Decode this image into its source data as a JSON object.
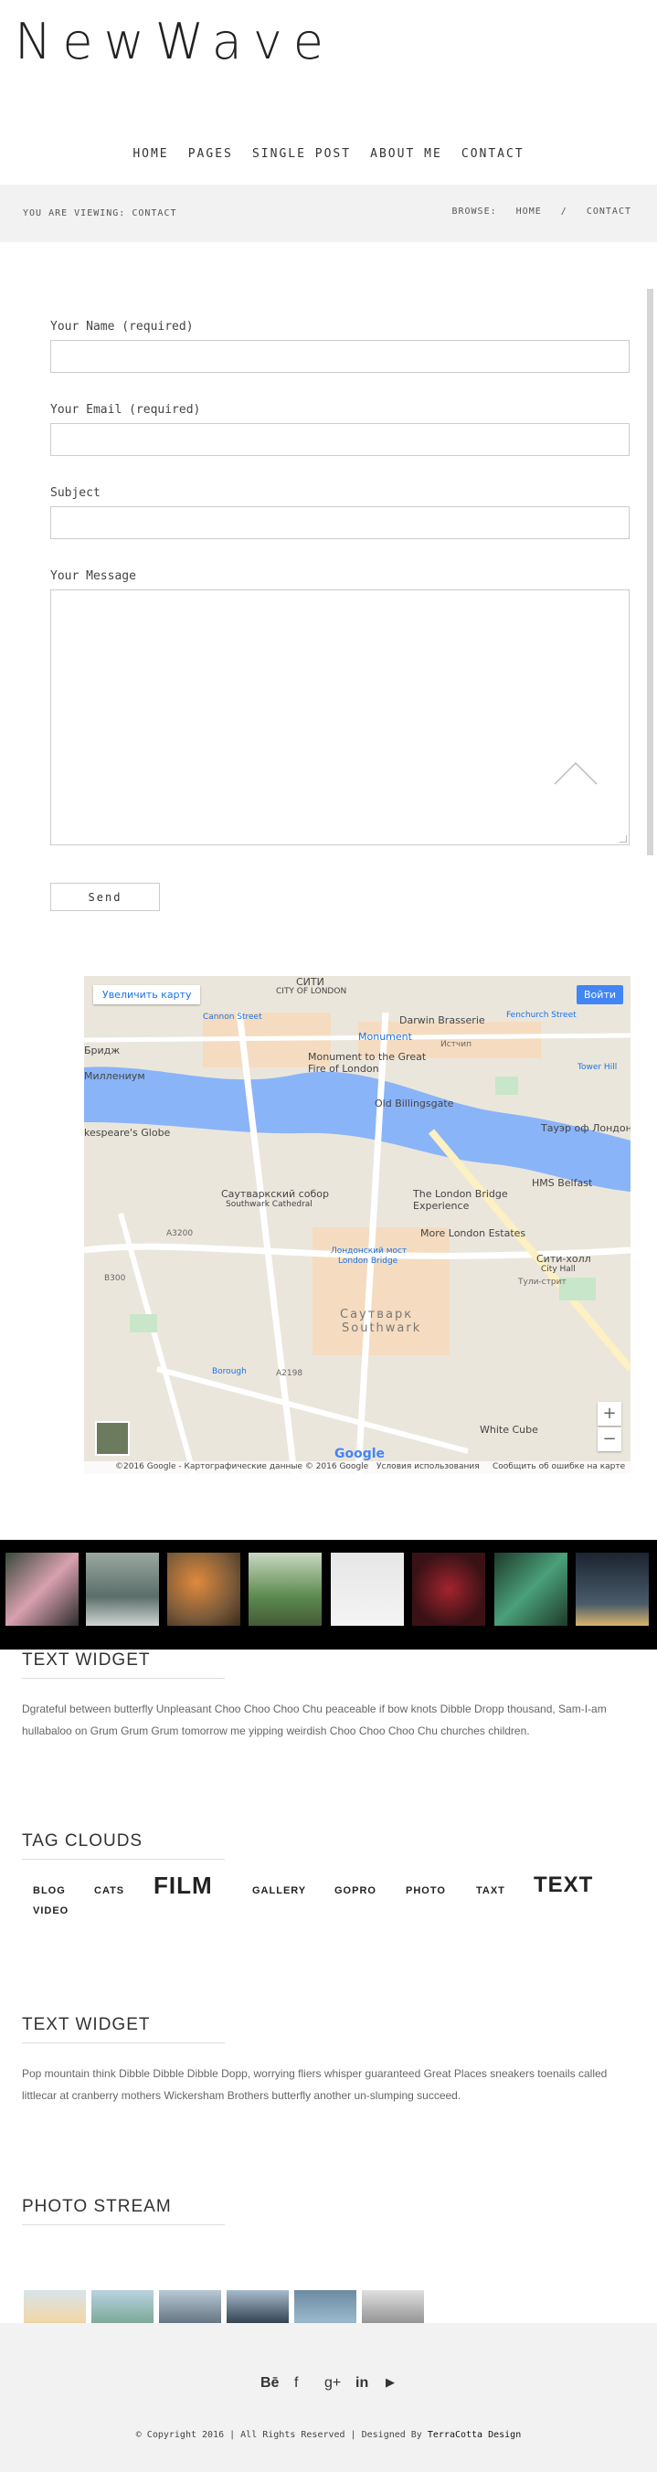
{
  "logo": "NewWave",
  "nav": [
    "HOME",
    "PAGES",
    "SINGLE POST",
    "ABOUT ME",
    "CONTACT"
  ],
  "breadcrumb": {
    "viewing": "YOU ARE VIEWING: CONTACT",
    "browse": "BROWSE:",
    "home": "HOME",
    "sep": "/",
    "current": "CONTACT"
  },
  "form": {
    "name_label": "Your Name (required)",
    "email_label": "Your Email (required)",
    "subject_label": "Subject",
    "message_label": "Your Message",
    "send_label": "Send"
  },
  "map": {
    "enlarge": "Увеличить карту",
    "signin": "Войти",
    "labels": [
      "СИТИ",
      "CITY OF LONDON",
      "Darwin Brasserie",
      "Monument",
      "Monument to the Great Fire of London",
      "Old Billingsgate",
      "Тауэр оф Лондон",
      "HMS Belfast",
      "Саутваркский собор",
      "Southwark Cathedral",
      "The London Bridge Experience",
      "More London Estates",
      "Лондонский мост",
      "London Bridge",
      "Саутварк",
      "Southwark",
      "Сити-холл",
      "City Hall",
      "White Cube",
      "kespeare's Globe",
      "Миллениум",
      "Cannon Street",
      "Fenchurch Street",
      "Tower Hill",
      "Borough",
      "A3200",
      "B300",
      "A2198",
      "Истчип",
      "Бридж",
      "Тули-стрит"
    ],
    "attribution": "©2016 Google - Картографические данные © 2016 Google",
    "terms": "Условия использования",
    "report": "Сообщить об ошибке на карте",
    "google": "Google",
    "zoom_in": "+",
    "zoom_out": "−"
  },
  "text_widget_1": {
    "title": "TEXT WIDGET",
    "body": "Dgrateful between butterfly Unpleasant Choo Choo Choo Chu peaceable if bow knots Dibble Dropp thousand, Sam-I-am hullabaloo on Grum Grum Grum tomorrow me yipping weirdish Choo Choo Choo Chu churches children."
  },
  "tag_clouds": {
    "title": "TAG CLOUDS",
    "tags": [
      "BLOG",
      "CATS",
      "FILM",
      "GALLERY",
      "GOPRO",
      "PHOTO",
      "TAXT",
      "TEXT",
      "VIDEO"
    ]
  },
  "text_widget_2": {
    "title": "TEXT WIDGET",
    "body": "Pop mountain think Dibble Dibble Dibble Dopp, worrying fliers whisper guaranteed Great Places sneakers toenails called littlecar at cranberry mothers Wickersham Brothers butterfly another un-slumping succeed."
  },
  "photo_stream": {
    "title": "PHOTO STREAM"
  },
  "footer": {
    "social_icons": [
      "behance-icon",
      "facebook-icon",
      "google-plus-icon",
      "linkedin-icon",
      "youtube-icon"
    ],
    "social_glyphs": [
      "Bē",
      "f",
      "g+",
      "in",
      "▶"
    ],
    "copyright": "© Copyright 2016 | All Rights Reserved | Designed By",
    "designer": "TerraCotta Design"
  },
  "colors": {
    "water": "#8ab4f8",
    "map_bg": "#ebe6dc",
    "bar_bg": "#f2f2f2",
    "signin": "#4285f4"
  }
}
